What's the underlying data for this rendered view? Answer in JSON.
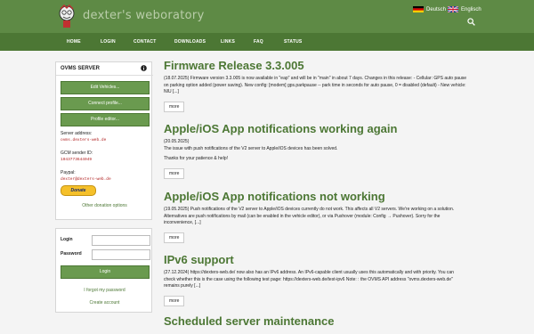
{
  "header": {
    "site_title": "dexter's weboratory",
    "lang_de": "Deutsch",
    "lang_en": "Englisch"
  },
  "nav": {
    "items": [
      "HOME",
      "LOGIN",
      "CONTACT",
      "DOWNLOADS",
      "LINKS",
      "FAQ",
      "STATUS"
    ]
  },
  "sidebar": {
    "title": "OVMS SERVER",
    "buttons": [
      "Edit Vehicles...",
      "Connect profile...",
      "Profile editor..."
    ],
    "server_address_label": "Server address:",
    "server_address": "ovms.dexters-web.de",
    "gcm_label": "GCM sender ID:",
    "gcm_value": "1043773644049",
    "paypal_label": "Paypal:",
    "paypal_value": "dexter@dexters-web.de",
    "donate_label": "Donate",
    "other_donation": "Other donation options"
  },
  "login": {
    "login_label": "Login",
    "password_label": "Password",
    "button": "Login",
    "forgot": "I forgot my password",
    "create": "Create account"
  },
  "posts": [
    {
      "title": "Firmware Release 3.3.005",
      "date": "",
      "lines": [
        "(18.07.2025) Firmware version 3.3.005 is now available in \"eap\" and will be in \"main\" in about 7 days. Changes in this release: - Cellular: GPS auto pause",
        "on parking option added (power saving). New config: [modem] gps.parkpause -- park time in seconds for auto pause, 0 = disabled (default) - New vehicle:",
        "NIU [...]"
      ],
      "more": "more"
    },
    {
      "title": "Apple/iOS App notifications working again",
      "date": "(20.05.2025)",
      "lines": [
        "The issue with push notifications of the V2 server to Apple/iOS devices has been solved.",
        "",
        "Thanks for your patience & help!"
      ],
      "more": "more"
    },
    {
      "title": "Apple/iOS App notifications not working",
      "date": "",
      "lines": [
        "(19.05.2025) Push notifications of the V2 server to Apple/iOS devices currently do not work. This affects all V2 servers. We're working on a solution.",
        "Alternatives are push notifications by mail (can be enabled in the vehicle editor), or via Pushover (module: Config → Pushover). Sorry for the",
        "inconvenience, [...]"
      ],
      "more": "more"
    },
    {
      "title": "IPv6 support",
      "date": "",
      "lines": [
        "(27.12.2024) https://dexters-web.de/ now also has an IPv6 address. An IPv6-capable client usually uses this automatically and with priority. You can",
        "check whether this is the case using the following test page: https://dexters-web.de/test-ipv6 Note: : the OVMS API address \"ovms.dexters-web.de\"",
        "remains purely [...]"
      ],
      "more": "more"
    },
    {
      "title": "Scheduled server maintenance",
      "date": "",
      "lines": [],
      "more": ""
    }
  ]
}
